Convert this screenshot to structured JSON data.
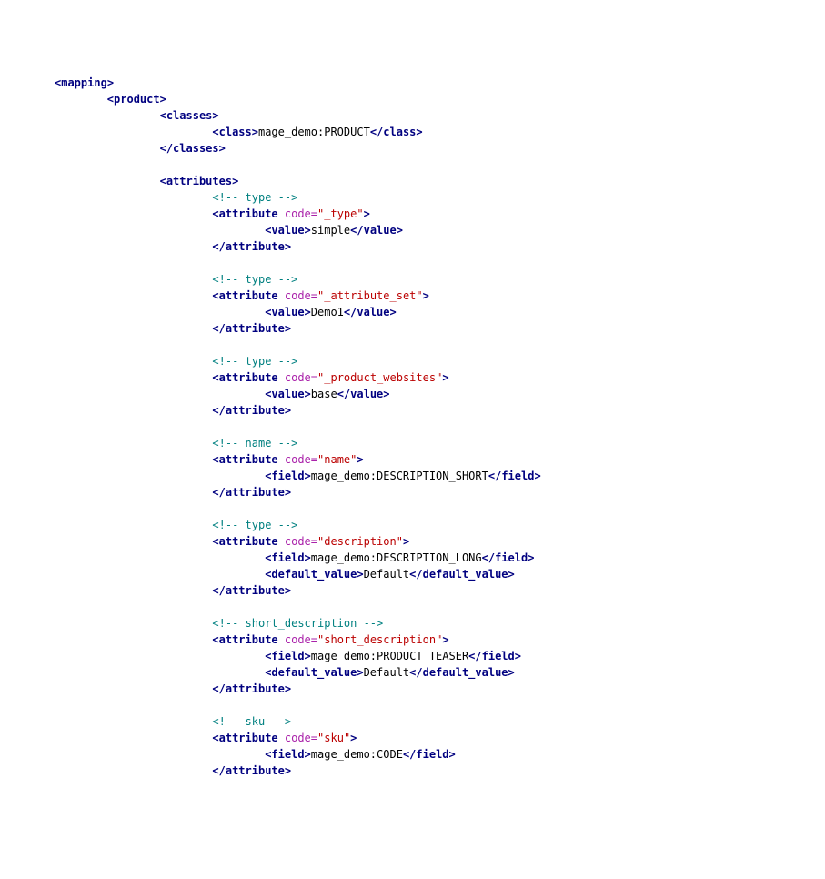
{
  "indentation": {
    "unit": "8 spaces",
    "base_level": 0
  },
  "xml": {
    "root": "mapping",
    "product": {
      "tag": "product",
      "classes": {
        "tag": "classes",
        "class_tag": "class",
        "class_value": "mage_demo:PRODUCT"
      },
      "attributes_tag": "attributes",
      "attributes": [
        {
          "comment": " type ",
          "code": "_type",
          "body": {
            "value_tag": "value",
            "value_text": "simple"
          }
        },
        {
          "comment": " type ",
          "code": "_attribute_set",
          "body": {
            "value_tag": "value",
            "value_text": "Demo1"
          }
        },
        {
          "comment": " type ",
          "code": "_product_websites",
          "body": {
            "value_tag": "value",
            "value_text": "base"
          }
        },
        {
          "comment": " name ",
          "code": "name",
          "body": {
            "field_tag": "field",
            "field_text": "mage_demo:DESCRIPTION_SHORT"
          }
        },
        {
          "comment": " type ",
          "code": "description",
          "body": {
            "field_tag": "field",
            "field_text": "mage_demo:DESCRIPTION_LONG",
            "default_value_tag": "default_value",
            "default_value_text": "Default"
          }
        },
        {
          "comment": " short_description ",
          "code": "short_description",
          "body": {
            "field_tag": "field",
            "field_text": "mage_demo:PRODUCT_TEASER",
            "default_value_tag": "default_value",
            "default_value_text": "Default"
          }
        },
        {
          "comment": " sku ",
          "code": "sku",
          "body": {
            "field_tag": "field",
            "field_text": "mage_demo:CODE"
          }
        }
      ]
    },
    "attr_name": "code"
  }
}
